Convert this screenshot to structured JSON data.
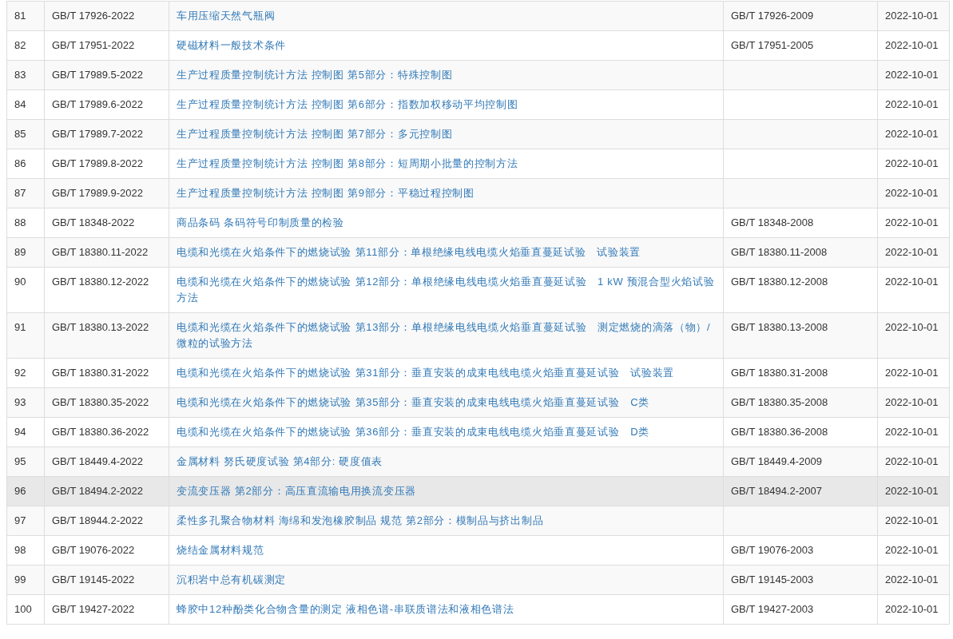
{
  "table": {
    "rows": [
      {
        "number": "81",
        "code": "GB/T 17926-2022",
        "title": "车用压缩天然气瓶阀",
        "replaces": "GB/T 17926-2009",
        "date": "2022-10-01",
        "hovered": false
      },
      {
        "number": "82",
        "code": "GB/T 17951-2022",
        "title": "硬磁材料一般技术条件",
        "replaces": "GB/T 17951-2005",
        "date": "2022-10-01",
        "hovered": false
      },
      {
        "number": "83",
        "code": "GB/T 17989.5-2022",
        "title": "生产过程质量控制统计方法 控制图 第5部分：特殊控制图",
        "date": "2022-10-01",
        "hovered": false
      },
      {
        "number": "84",
        "code": "GB/T 17989.6-2022",
        "title": "生产过程质量控制统计方法 控制图 第6部分：指数加权移动平均控制图",
        "date": "2022-10-01",
        "hovered": false
      },
      {
        "number": "85",
        "code": "GB/T 17989.7-2022",
        "title": "生产过程质量控制统计方法 控制图 第7部分：多元控制图",
        "date": "2022-10-01",
        "hovered": false
      },
      {
        "number": "86",
        "code": "GB/T 17989.8-2022",
        "title": "生产过程质量控制统计方法 控制图 第8部分：短周期小批量的控制方法",
        "date": "2022-10-01",
        "hovered": false
      },
      {
        "number": "87",
        "code": "GB/T 17989.9-2022",
        "title": "生产过程质量控制统计方法 控制图 第9部分：平稳过程控制图",
        "date": "2022-10-01",
        "hovered": false
      },
      {
        "number": "88",
        "code": "GB/T 18348-2022",
        "title": "商品条码 条码符号印制质量的检验",
        "replaces": "GB/T 18348-2008",
        "date": "2022-10-01",
        "hovered": false
      },
      {
        "number": "89",
        "code": "GB/T 18380.11-2022",
        "title": "电缆和光缆在火焰条件下的燃烧试验 第11部分：单根绝缘电线电缆火焰垂直蔓延试验　试验装置",
        "replaces": "GB/T 18380.11-2008",
        "date": "2022-10-01",
        "hovered": false
      },
      {
        "number": "90",
        "code": "GB/T 18380.12-2022",
        "title": "电缆和光缆在火焰条件下的燃烧试验 第12部分：单根绝缘电线电缆火焰垂直蔓延试验　1 kW 预混合型火焰试验方法",
        "replaces": "GB/T 18380.12-2008",
        "date": "2022-10-01",
        "hovered": false
      },
      {
        "number": "91",
        "code": "GB/T 18380.13-2022",
        "title": "电缆和光缆在火焰条件下的燃烧试验 第13部分：单根绝缘电线电缆火焰垂直蔓延试验　测定燃烧的滴落（物）/微粒的试验方法",
        "replaces": "GB/T 18380.13-2008",
        "date": "2022-10-01",
        "hovered": false
      },
      {
        "number": "92",
        "code": "GB/T 18380.31-2022",
        "title": "电缆和光缆在火焰条件下的燃烧试验 第31部分：垂直安装的成束电线电缆火焰垂直蔓延试验　试验装置",
        "replaces": "GB/T 18380.31-2008",
        "date": "2022-10-01",
        "hovered": false
      },
      {
        "number": "93",
        "code": "GB/T 18380.35-2022",
        "title": "电缆和光缆在火焰条件下的燃烧试验 第35部分：垂直安装的成束电线电缆火焰垂直蔓延试验　C类",
        "replaces": "GB/T 18380.35-2008",
        "date": "2022-10-01",
        "hovered": false
      },
      {
        "number": "94",
        "code": "GB/T 18380.36-2022",
        "title": "电缆和光缆在火焰条件下的燃烧试验 第36部分：垂直安装的成束电线电缆火焰垂直蔓延试验　D类",
        "replaces": "GB/T 18380.36-2008",
        "date": "2022-10-01",
        "hovered": false
      },
      {
        "number": "95",
        "code": "GB/T 18449.4-2022",
        "title": "金属材料 努氏硬度试验 第4部分: 硬度值表",
        "replaces": "GB/T 18449.4-2009",
        "date": "2022-10-01",
        "hovered": false
      },
      {
        "number": "96",
        "code": "GB/T 18494.2-2022",
        "title": "变流变压器 第2部分：高压直流输电用换流变压器",
        "replaces": "GB/T 18494.2-2007",
        "date": "2022-10-01",
        "hovered": true
      },
      {
        "number": "97",
        "code": "GB/T 18944.2-2022",
        "title": "柔性多孔聚合物材料 海绵和发泡橡胶制品 规范 第2部分：模制品与挤出制品",
        "date": "2022-10-01",
        "hovered": false
      },
      {
        "number": "98",
        "code": "GB/T 19076-2022",
        "title": "烧结金属材料规范",
        "replaces": "GB/T 19076-2003",
        "date": "2022-10-01",
        "hovered": false
      },
      {
        "number": "99",
        "code": "GB/T 19145-2022",
        "title": "沉积岩中总有机碳测定",
        "replaces": "GB/T 19145-2003",
        "date": "2022-10-01",
        "hovered": false
      },
      {
        "number": "100",
        "code": "GB/T 19427-2022",
        "title": "蜂胶中12种酚类化合物含量的测定 液相色谱-串联质谱法和液相色谱法",
        "replaces": "GB/T 19427-2003",
        "date": "2022-10-01",
        "hovered": false
      }
    ]
  }
}
